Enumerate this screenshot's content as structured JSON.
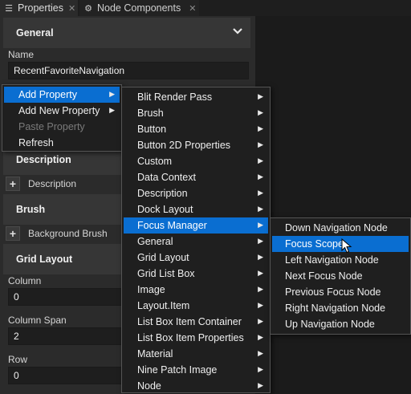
{
  "tabs": [
    {
      "label": "Properties",
      "icon": "list-icon",
      "close": "✕"
    },
    {
      "label": "Node Components",
      "icon": "component-icon",
      "close": "✕"
    }
  ],
  "sections": {
    "general": "General",
    "description": "Description",
    "brush": "Brush",
    "grid_layout": "Grid Layout"
  },
  "fields": {
    "name_label": "Name",
    "name_value": "RecentFavoriteNavigation",
    "column_label": "Column",
    "column_value": "0",
    "column_span_label": "Column Span",
    "column_span_value": "2",
    "row_label": "Row",
    "row_value": "0"
  },
  "add_rows": {
    "description": "Description",
    "background_brush": "Background Brush",
    "plus": "+"
  },
  "context_menu": [
    {
      "label": "Add Property",
      "submenu": true,
      "highlighted": true
    },
    {
      "label": "Add New Property",
      "submenu": true
    },
    {
      "label": "Paste Property",
      "disabled": true
    },
    {
      "label": "Refresh"
    }
  ],
  "property_menu": [
    "Blit Render Pass",
    "Brush",
    "Button",
    "Button 2D Properties",
    "Custom",
    "Data Context",
    "Description",
    "Dock Layout",
    "Focus Manager",
    "General",
    "Grid Layout",
    "Grid List Box",
    "Image",
    "Layout.Item",
    "List Box Item Container",
    "List Box Item Properties",
    "Material",
    "Nine Patch Image",
    "Node"
  ],
  "property_menu_highlighted": "Focus Manager",
  "focus_menu": [
    "Down Navigation Node",
    "Focus Scope",
    "Left Navigation Node",
    "Next Focus Node",
    "Previous Focus Node",
    "Right Navigation Node",
    "Up Navigation Node"
  ],
  "focus_menu_highlighted": "Focus Scope",
  "colors": {
    "highlight": "#0a6ed1",
    "panel": "#2b2b2b",
    "menu_bg": "#1f1f1f"
  }
}
